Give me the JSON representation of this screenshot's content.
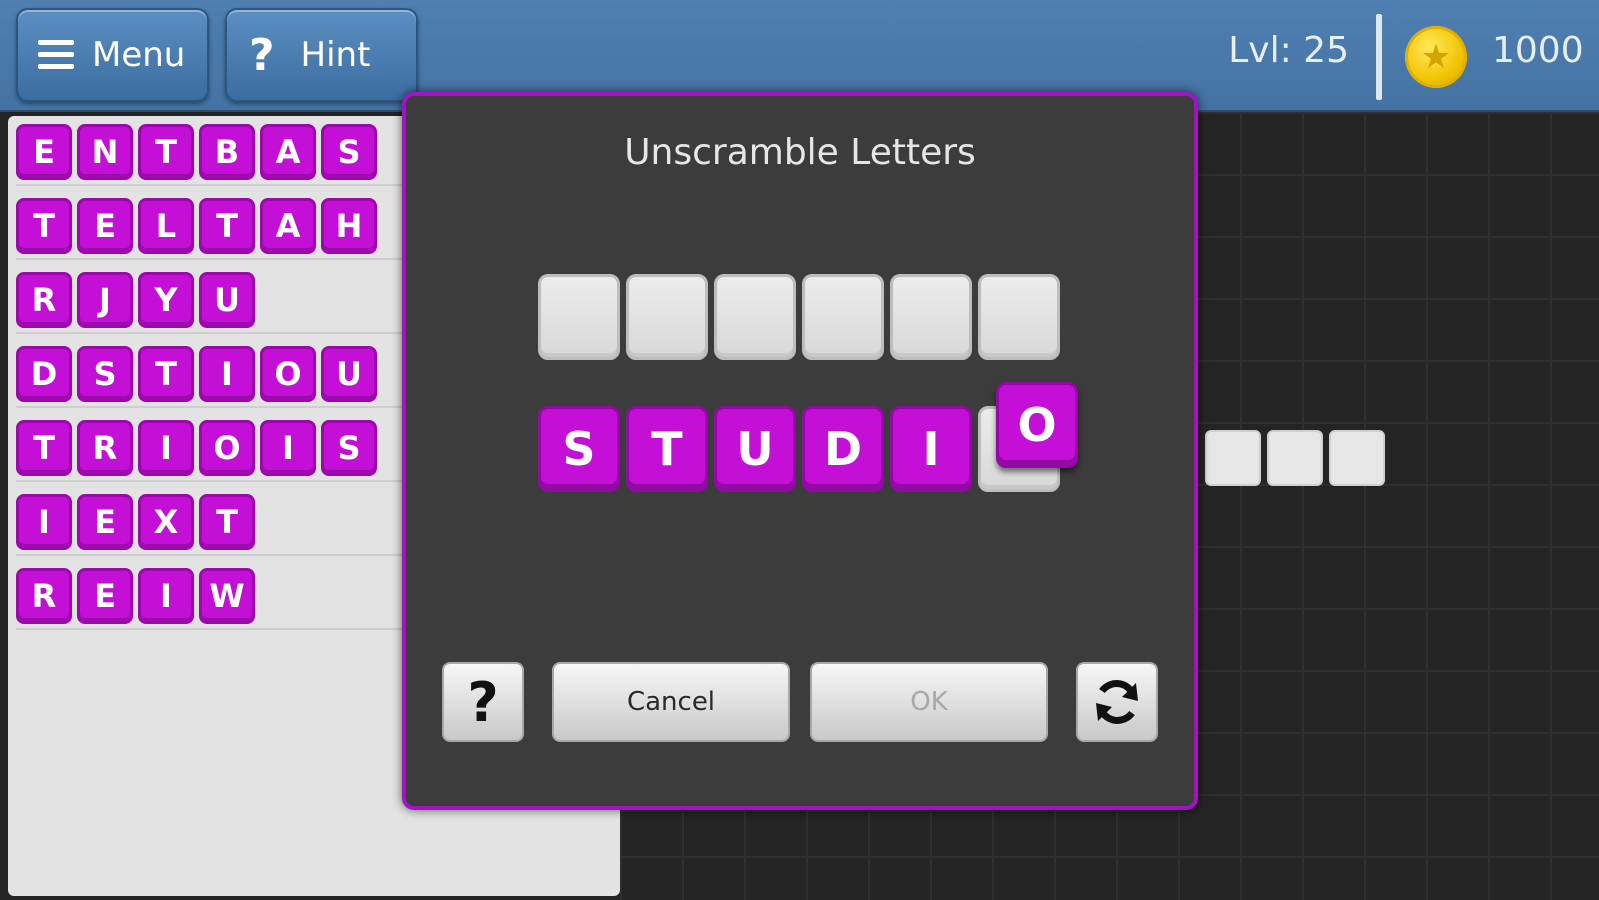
{
  "topbar": {
    "menu_label": "Menu",
    "hint_label": "Hint",
    "level_text": "Lvl: 25",
    "coins": "1000",
    "coin_icon": "star-coin-icon"
  },
  "rows": [
    [
      "E",
      "N",
      "T",
      "B",
      "A",
      "S"
    ],
    [
      "T",
      "E",
      "L",
      "T",
      "A",
      "H"
    ],
    [
      "R",
      "J",
      "Y",
      "U"
    ],
    [
      "D",
      "S",
      "T",
      "I",
      "O",
      "U"
    ],
    [
      "T",
      "R",
      "I",
      "O",
      "I",
      "S"
    ],
    [
      "I",
      "E",
      "X",
      "T"
    ],
    [
      "R",
      "E",
      "I",
      "W"
    ]
  ],
  "dialog": {
    "title": "Unscramble Letters",
    "letters": [
      "S",
      "T",
      "U",
      "D",
      "I",
      "O"
    ],
    "help_label": "?",
    "cancel_label": "Cancel",
    "ok_label": "OK",
    "refresh_icon": "refresh-icon"
  },
  "colors": {
    "tile": "#c40fd6",
    "dialog_border": "#a312c4",
    "topbar": "#4a7aab"
  }
}
